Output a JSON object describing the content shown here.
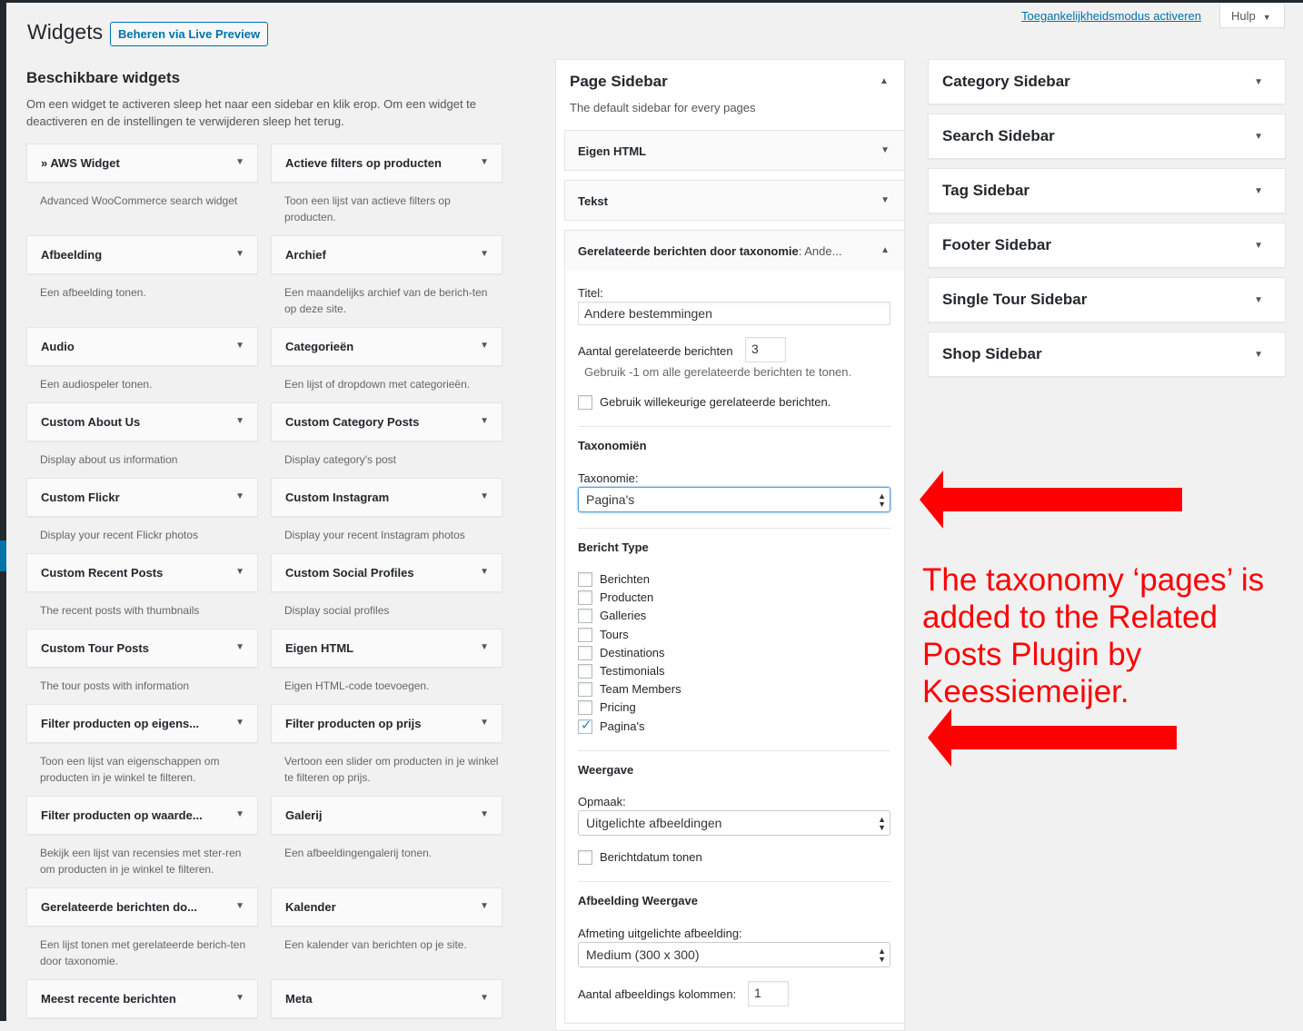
{
  "header": {
    "title": "Widgets",
    "live_preview_button": "Beheren via Live Preview",
    "accessibility_link": "Toegankelijkheidsmodus activeren",
    "help_button": "Hulp"
  },
  "available": {
    "title": "Beschikbare widgets",
    "description": "Om een widget te activeren sleep het naar een sidebar en klik erop. Om een widget te deactiveren en de instellingen te verwijderen sleep het terug.",
    "widgets": [
      {
        "title": "» AWS Widget",
        "desc": "Advanced WooCommerce search widget"
      },
      {
        "title": "Actieve filters op producten",
        "desc": "Toon een lijst van actieve filters op producten."
      },
      {
        "title": "Afbeelding",
        "desc": "Een afbeelding tonen."
      },
      {
        "title": "Archief",
        "desc": "Een maandelijks archief van de berich-ten op deze site."
      },
      {
        "title": "Audio",
        "desc": "Een audiospeler tonen."
      },
      {
        "title": "Categorieën",
        "desc": "Een lijst of dropdown met categorieën."
      },
      {
        "title": "Custom About Us",
        "desc": "Display about us information"
      },
      {
        "title": "Custom Category Posts",
        "desc": "Display category's post"
      },
      {
        "title": "Custom Flickr",
        "desc": "Display your recent Flickr photos"
      },
      {
        "title": "Custom Instagram",
        "desc": "Display your recent Instagram photos"
      },
      {
        "title": "Custom Recent Posts",
        "desc": "The recent posts with thumbnails"
      },
      {
        "title": "Custom Social Profiles",
        "desc": "Display social profiles"
      },
      {
        "title": "Custom Tour Posts",
        "desc": "The tour posts with information"
      },
      {
        "title": "Eigen HTML",
        "desc": "Eigen HTML-code toevoegen."
      },
      {
        "title": "Filter producten op eigens...",
        "desc": "Toon een lijst van eigenschappen om producten in je winkel te filteren."
      },
      {
        "title": "Filter producten op prijs",
        "desc": "Vertoon een slider om producten in je winkel te filteren op prijs."
      },
      {
        "title": "Filter producten op waarde...",
        "desc": "Bekijk een lijst van recensies met ster-ren om producten in je winkel te filteren."
      },
      {
        "title": "Galerij",
        "desc": "Een afbeeldingengalerij tonen."
      },
      {
        "title": "Gerelateerde berichten do...",
        "desc": "Een lijst tonen met gerelateerde berich-ten door taxonomie."
      },
      {
        "title": "Kalender",
        "desc": "Een kalender van berichten op je site."
      },
      {
        "title": "Meest recente berichten",
        "desc": ""
      },
      {
        "title": "Meta",
        "desc": ""
      }
    ]
  },
  "page_sidebar": {
    "title": "Page Sidebar",
    "description": "The default sidebar for every pages",
    "widgets": [
      "Eigen HTML",
      "Tekst"
    ],
    "open_widget": {
      "title": "Gerelateerde berichten door taxonomie",
      "subtitle": ": Ande...",
      "form": {
        "titel_label": "Titel:",
        "titel_value": "Andere bestemmingen",
        "count_label": "Aantal gerelateerde berichten",
        "count_value": "3",
        "count_hint": "Gebruik -1 om alle gerelateerde berichten te tonen.",
        "random_label": "Gebruik willekeurige gerelateerde berichten.",
        "tax_section": "Taxonomiën",
        "tax_label": "Taxonomie:",
        "tax_value": "Pagina's",
        "post_type_section": "Bericht Type",
        "post_types": [
          {
            "label": "Berichten",
            "checked": false
          },
          {
            "label": "Producten",
            "checked": false
          },
          {
            "label": "Galleries",
            "checked": false
          },
          {
            "label": "Tours",
            "checked": false
          },
          {
            "label": "Destinations",
            "checked": false
          },
          {
            "label": "Testimonials",
            "checked": false
          },
          {
            "label": "Team Members",
            "checked": false
          },
          {
            "label": "Pricing",
            "checked": false
          },
          {
            "label": "Pagina's",
            "checked": true
          }
        ],
        "display_section": "Weergave",
        "layout_label": "Opmaak:",
        "layout_value": "Uitgelichte afbeeldingen",
        "date_label": "Berichtdatum tonen",
        "image_section": "Afbeelding Weergave",
        "size_label": "Afmeting uitgelichte afbeelding:",
        "size_value": "Medium (300 x 300)",
        "columns_label": "Aantal afbeeldings kolommen:",
        "columns_value": "1"
      }
    }
  },
  "sidebars": [
    "Category Sidebar",
    "Search Sidebar",
    "Tag Sidebar",
    "Footer Sidebar",
    "Single Tour Sidebar",
    "Shop Sidebar"
  ],
  "annotation": {
    "text": "The taxonomy ‘pages’ is added to the Related Posts Plugin by Keessiemeijer.",
    "color": "#ff0000"
  },
  "colors": {
    "accent": "#0073aa",
    "background": "#f1f1f1"
  }
}
